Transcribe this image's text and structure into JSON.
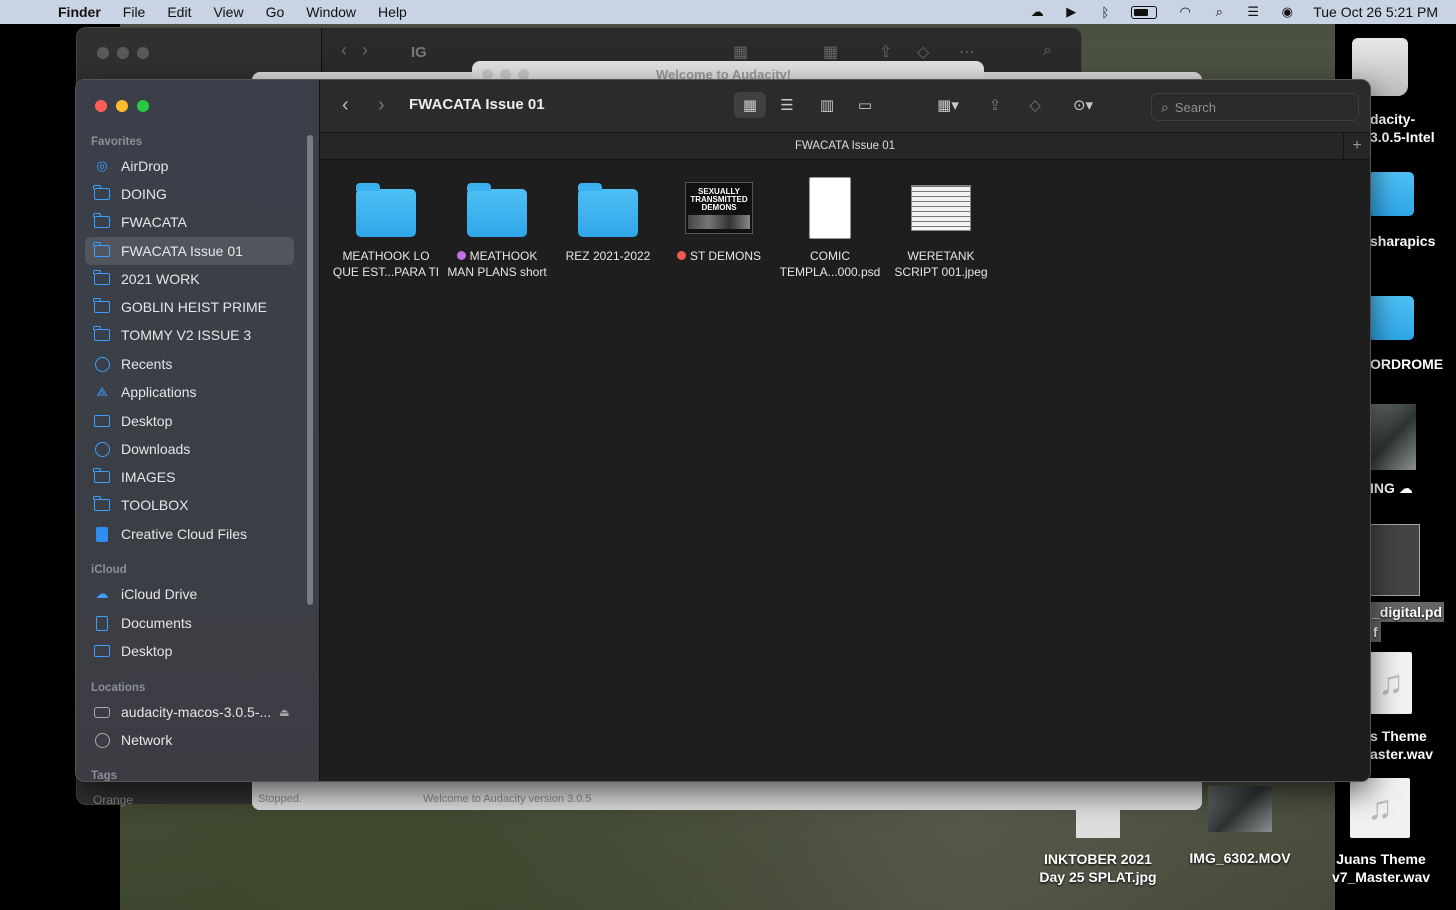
{
  "menubar": {
    "apple": "",
    "app": "Finder",
    "items": [
      "File",
      "Edit",
      "View",
      "Go",
      "Window",
      "Help"
    ],
    "clock": "Tue Oct 26  5:21 PM"
  },
  "back_window": {
    "title": "IG",
    "tags_peek": "Orange"
  },
  "audacity": {
    "title": "Welcome to Audacity!",
    "status_left": "Stopped.",
    "status_right": "Welcome to Audacity version 3.0.5"
  },
  "finder": {
    "title": "FWACATA Issue 01",
    "path": "FWACATA Issue 01",
    "search_placeholder": "Search",
    "sidebar": {
      "favorites_header": "Favorites",
      "favorites": [
        {
          "label": "AirDrop",
          "icon": "airdrop-icon"
        },
        {
          "label": "DOING",
          "icon": "folder-icon"
        },
        {
          "label": "FWACATA",
          "icon": "folder-icon"
        },
        {
          "label": "FWACATA Issue 01",
          "icon": "folder-icon",
          "selected": true
        },
        {
          "label": "2021 WORK",
          "icon": "folder-icon"
        },
        {
          "label": "GOBLIN HEIST PRIME",
          "icon": "folder-icon"
        },
        {
          "label": "TOMMY V2 ISSUE 3",
          "icon": "folder-icon"
        },
        {
          "label": "Recents",
          "icon": "clock-icon"
        },
        {
          "label": "Applications",
          "icon": "applications-icon"
        },
        {
          "label": "Desktop",
          "icon": "desktop-icon"
        },
        {
          "label": "Downloads",
          "icon": "download-icon"
        },
        {
          "label": "IMAGES",
          "icon": "folder-icon"
        },
        {
          "label": "TOOLBOX",
          "icon": "folder-icon"
        },
        {
          "label": "Creative Cloud Files",
          "icon": "document-icon"
        }
      ],
      "icloud_header": "iCloud",
      "icloud": [
        {
          "label": "iCloud Drive",
          "icon": "cloud-icon"
        },
        {
          "label": "Documents",
          "icon": "document-icon"
        },
        {
          "label": "Desktop",
          "icon": "desktop-icon"
        }
      ],
      "locations_header": "Locations",
      "locations": [
        {
          "label": "audacity-macos-3.0.5-...",
          "icon": "drive-icon"
        },
        {
          "label": "Network",
          "icon": "globe-icon"
        }
      ],
      "tags_header": "Tags"
    },
    "files": [
      {
        "line1": "MEATHOOK LO",
        "line2": "QUE EST...PARA TI",
        "kind": "folder",
        "tag": ""
      },
      {
        "line1": "MEATHOOK",
        "line2": "MAN PLANS short",
        "kind": "folder",
        "tag": "#c26fe0"
      },
      {
        "line1": "REZ 2021-2022",
        "line2": "",
        "kind": "folder",
        "tag": ""
      },
      {
        "line1": "ST DEMONS",
        "line2": "",
        "kind": "image",
        "tag": "#ef5a52",
        "thumb_text": "SEXUALLY TRANSMITTED DEMONS"
      },
      {
        "line1": "COMIC",
        "line2": "TEMPLA...000.psd",
        "kind": "psd",
        "tag": ""
      },
      {
        "line1": "WERETANK",
        "line2": "SCRIPT 001.jpeg",
        "kind": "jpeg",
        "tag": ""
      }
    ]
  },
  "desktop": {
    "items": [
      {
        "line1": "dacity-",
        "line2": "3.0.5-Intel"
      },
      {
        "line1": "sharapics",
        "line2": ""
      },
      {
        "line1": "ORDROME",
        "line2": ""
      },
      {
        "line1": "ING",
        "line2": ""
      },
      {
        "line1": "_digital.pd",
        "line2": "f"
      },
      {
        "line1": "s Theme",
        "line2": "aster.wav"
      },
      {
        "line1": "INKTOBER 2021",
        "line2": "Day 25 SPLAT.jpg"
      },
      {
        "line1": "IMG_6302.MOV",
        "line2": ""
      },
      {
        "line1": "Juans Theme",
        "line2": "v7_Master.wav"
      }
    ]
  }
}
